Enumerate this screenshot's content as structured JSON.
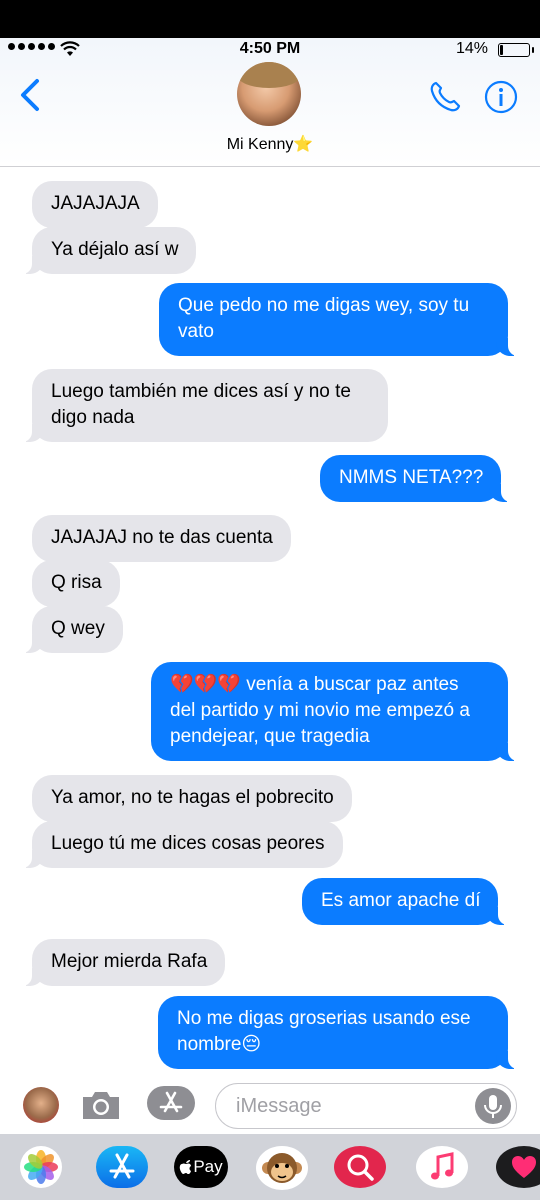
{
  "status": {
    "time": "4:50 PM",
    "battery": "14%"
  },
  "contact": {
    "name": "Mi Kenny⭐️"
  },
  "messages": [
    {
      "text": "JAJAJAJA",
      "from": "them"
    },
    {
      "text": "Ya déjalo así w",
      "from": "them"
    },
    {
      "text": "Que pedo no me digas wey, soy tu",
      "text2": "vato",
      "from": "me"
    },
    {
      "text": "Luego también me dices así y no te",
      "text2": "digo nada",
      "from": "them"
    },
    {
      "text": "NMMS NETA???",
      "from": "me"
    },
    {
      "text": "JAJAJAJ no te das cuenta",
      "from": "them"
    },
    {
      "text": "Q risa",
      "from": "them"
    },
    {
      "text": "Q wey",
      "from": "them"
    },
    {
      "text": "💔💔💔 venía a buscar paz antes",
      "text2": "del partido y mi novio me empezó a",
      "text3": "pendejear, que tragedia",
      "from": "me"
    },
    {
      "text": "Ya amor, no te hagas el pobrecito",
      "from": "them"
    },
    {
      "text": "Luego tú me dices cosas peores",
      "from": "them"
    },
    {
      "text": "Es amor apache dí",
      "from": "me"
    },
    {
      "text": "Mejor mierda Rafa",
      "from": "them"
    },
    {
      "text": "No me digas groserias usando ese",
      "text2": "nombre😔",
      "from": "me"
    }
  ],
  "composer": {
    "placeholder": "iMessage"
  },
  "apps": {
    "apple_pay_label": "Pay"
  },
  "colors": {
    "outgoing": "#0b7cff",
    "incoming": "#e5e5ea",
    "accent": "#0b7cff"
  },
  "icons": [
    "back-chevron-icon",
    "phone-icon",
    "info-icon",
    "camera-icon",
    "app-store-icon",
    "microphone-icon",
    "photos-icon",
    "apple-pay-icon",
    "animoji-icon",
    "search-images-icon",
    "music-icon",
    "digital-touch-icon"
  ]
}
